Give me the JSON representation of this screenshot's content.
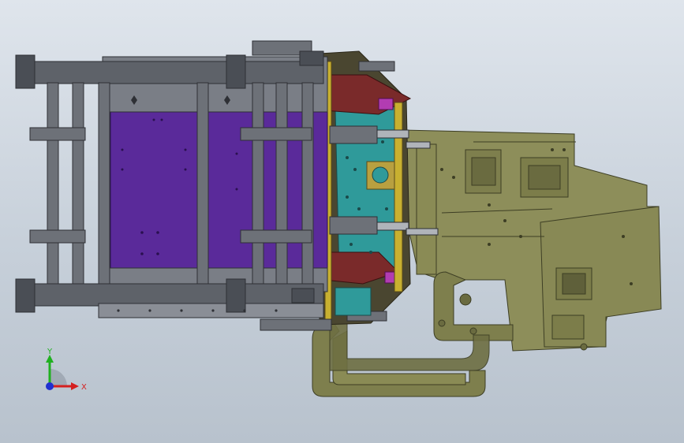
{
  "view": {
    "background_top": "#dfe5ec",
    "background_bottom": "#b8c2cd"
  },
  "colors": {
    "frame": "#6d7178",
    "frame_dark": "#4a4e55",
    "plate_purple": "#5a2a9a",
    "olive": "#8d8e5a",
    "olive_dark": "#5f603a",
    "teal": "#2f9a9a",
    "maroon": "#7a2a2a",
    "magenta": "#b23cb2",
    "yellow": "#c8b030"
  },
  "triad": {
    "x_label": "X",
    "y_label": "Y",
    "x_color": "#d42020",
    "y_color": "#20b020",
    "z_color": "#2030d0"
  }
}
